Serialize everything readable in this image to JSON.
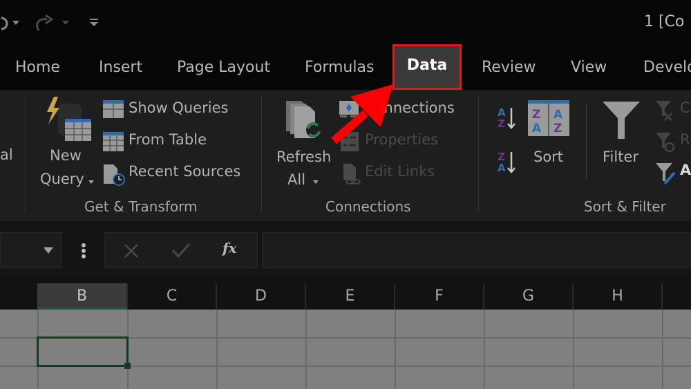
{
  "titlebar": {
    "title_fragment": "1  [Co",
    "qat": {
      "undo_icon": "undo-icon",
      "redo_icon": "redo-icon",
      "customize_icon": "customize-qat-icon"
    }
  },
  "tabs": [
    {
      "label": "Home"
    },
    {
      "label": "Insert"
    },
    {
      "label": "Page Layout"
    },
    {
      "label": "Formulas"
    },
    {
      "label": "Data",
      "active": true
    },
    {
      "label": "Review"
    },
    {
      "label": "View"
    },
    {
      "label": "Develo"
    }
  ],
  "ribbon": {
    "partial_left_label": "al",
    "get_transform": {
      "group_label": "Get & Transform",
      "new_query": {
        "line1": "New",
        "line2": "Query"
      },
      "show_queries": "Show Queries",
      "from_table": "From Table",
      "recent_sources": "Recent Sources"
    },
    "connections": {
      "group_label": "Connections",
      "refresh_all": {
        "line1": "Refresh",
        "line2": "All"
      },
      "connections": "Connections",
      "properties": "Properties",
      "edit_links": "Edit Links"
    },
    "sort_filter": {
      "group_label": "Sort & Filter",
      "sort_az_icon": "sort-a-to-z-icon",
      "sort_za_icon": "sort-z-to-a-icon",
      "sort": "Sort",
      "filter": "Filter",
      "clear_partial": "C",
      "reapply_partial": "R",
      "advanced_partial": "A"
    }
  },
  "formula_bar": {
    "name_box_value": "",
    "cancel_icon": "cancel-icon",
    "enter_icon": "enter-icon",
    "fx_label": "fx",
    "formula_value": ""
  },
  "grid": {
    "columns": [
      "B",
      "C",
      "D",
      "E",
      "F",
      "G",
      "H"
    ],
    "selected_column": "B"
  },
  "annotation": {
    "highlight_color": "#e0171b",
    "arrow_color": "#ff0000"
  }
}
